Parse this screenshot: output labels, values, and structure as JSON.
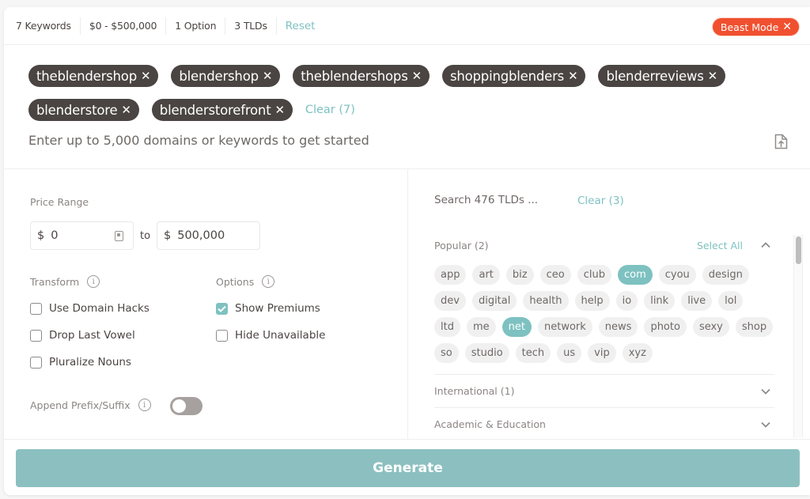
{
  "summary": {
    "keywords": "7 Keywords",
    "price": "$0 - $500,000",
    "options": "1 Option",
    "tlds": "3 TLDs",
    "reset": "Reset",
    "beast_mode": "Beast Mode",
    "beast_close": "✕"
  },
  "keywords": {
    "chips": [
      "theblendershop",
      "blendershop",
      "theblendershops",
      "shoppingblenders",
      "blenderreviews",
      "blenderstore",
      "blenderstorefront"
    ],
    "remove_glyph": "✕",
    "clear": "Clear (7)",
    "placeholder": "Enter up to 5,000 domains or keywords to get started"
  },
  "price_range": {
    "label": "Price Range",
    "currency": "$",
    "min": "0",
    "to": "to",
    "max": "500,000"
  },
  "transform": {
    "label": "Transform",
    "info": "i",
    "items": [
      {
        "label": "Use Domain Hacks",
        "checked": false
      },
      {
        "label": "Drop Last Vowel",
        "checked": false
      },
      {
        "label": "Pluralize Nouns",
        "checked": false
      }
    ]
  },
  "options": {
    "label": "Options",
    "info": "i",
    "items": [
      {
        "label": "Show Premiums",
        "checked": true
      },
      {
        "label": "Hide Unavailable",
        "checked": false
      }
    ]
  },
  "append": {
    "label": "Append Prefix/Suffix",
    "info": "i",
    "enabled": false
  },
  "tld_panel": {
    "search_placeholder": "Search 476 TLDs ...",
    "clear": "Clear (3)",
    "groups": [
      {
        "title": "Popular (2)",
        "select_all": "Select All",
        "expanded": true,
        "tlds": [
          {
            "name": "app",
            "selected": false
          },
          {
            "name": "art",
            "selected": false
          },
          {
            "name": "biz",
            "selected": false
          },
          {
            "name": "ceo",
            "selected": false
          },
          {
            "name": "club",
            "selected": false
          },
          {
            "name": "com",
            "selected": true
          },
          {
            "name": "cyou",
            "selected": false
          },
          {
            "name": "design",
            "selected": false
          },
          {
            "name": "dev",
            "selected": false
          },
          {
            "name": "digital",
            "selected": false
          },
          {
            "name": "health",
            "selected": false
          },
          {
            "name": "help",
            "selected": false
          },
          {
            "name": "io",
            "selected": false
          },
          {
            "name": "link",
            "selected": false
          },
          {
            "name": "live",
            "selected": false
          },
          {
            "name": "lol",
            "selected": false
          },
          {
            "name": "ltd",
            "selected": false
          },
          {
            "name": "me",
            "selected": false
          },
          {
            "name": "net",
            "selected": true
          },
          {
            "name": "network",
            "selected": false
          },
          {
            "name": "news",
            "selected": false
          },
          {
            "name": "photo",
            "selected": false
          },
          {
            "name": "sexy",
            "selected": false
          },
          {
            "name": "shop",
            "selected": false
          },
          {
            "name": "so",
            "selected": false
          },
          {
            "name": "studio",
            "selected": false
          },
          {
            "name": "tech",
            "selected": false
          },
          {
            "name": "us",
            "selected": false
          },
          {
            "name": "vip",
            "selected": false
          },
          {
            "name": "xyz",
            "selected": false
          }
        ]
      },
      {
        "title": "International (1)",
        "expanded": false
      },
      {
        "title": "Academic & Education",
        "expanded": false
      }
    ]
  },
  "generate": "Generate",
  "colors": {
    "accent": "#7ec1c1",
    "beast_mode": "#f0502f",
    "chip": "#4a4542",
    "generate": "#8cc0c0"
  }
}
